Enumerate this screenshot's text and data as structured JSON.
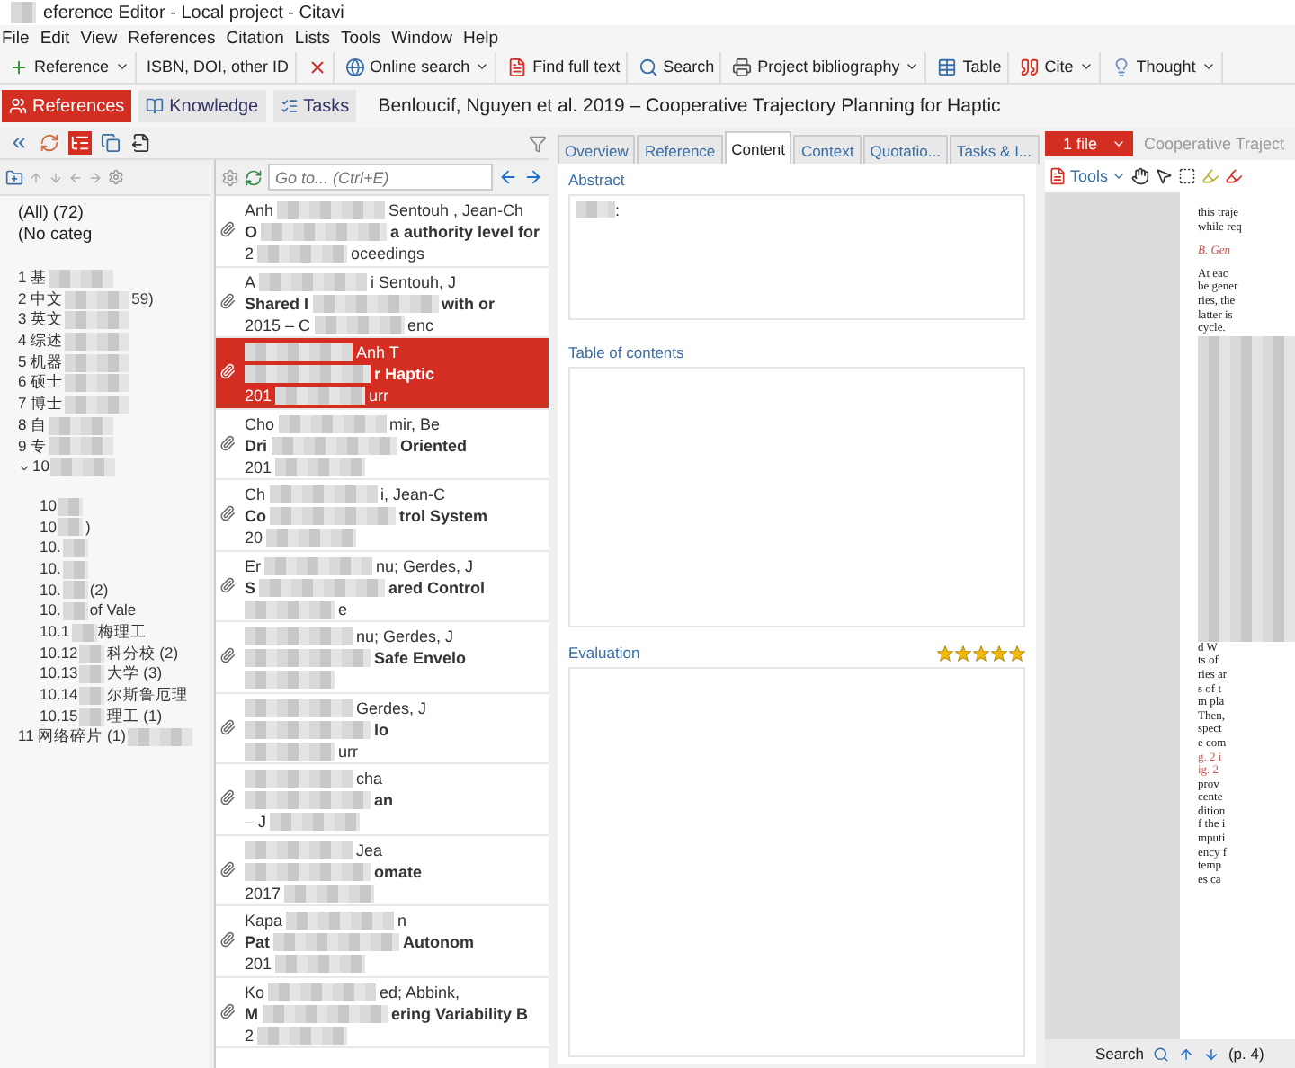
{
  "window": {
    "title": "eference Editor - Local project - Citavi"
  },
  "menu": [
    "File",
    "Edit",
    "View",
    "References",
    "Citation",
    "Lists",
    "Tools",
    "Window",
    "Help"
  ],
  "toolbar": [
    {
      "kind": "button",
      "label": "Reference",
      "dropdown": true
    },
    {
      "kind": "button",
      "label": "ISBN, DOI, other ID",
      "dropdown": false
    },
    {
      "kind": "delete"
    },
    {
      "kind": "button",
      "label": "Online search",
      "dropdown": true
    },
    {
      "kind": "button",
      "label": "Find full text",
      "dropdown": false
    },
    {
      "kind": "button",
      "label": "Search",
      "dropdown": false
    },
    {
      "kind": "button",
      "label": "Project bibliography",
      "dropdown": true
    },
    {
      "kind": "button",
      "label": "Table",
      "dropdown": false
    },
    {
      "kind": "button",
      "label": "Cite",
      "dropdown": true
    },
    {
      "kind": "button",
      "label": "Thought",
      "dropdown": true
    }
  ],
  "nav_tabs": [
    {
      "label": "References",
      "selected": true
    },
    {
      "label": "Knowledge",
      "selected": false
    },
    {
      "label": "Tasks",
      "selected": false
    }
  ],
  "heading": "Benloucif, Nguyen et al. 2019 – Cooperative Trajectory Planning for Haptic",
  "categories": {
    "fixed": [
      "(All) (72)",
      "(No categ"
    ],
    "tree": [
      {
        "start": "1 基"
      },
      {
        "start": "2 中文",
        "end": "59)"
      },
      {
        "start": "3 英文"
      },
      {
        "start": "4 综述"
      },
      {
        "start": "5 机器"
      },
      {
        "start": "6 硕士"
      },
      {
        "start": "7 博士"
      },
      {
        "start": "8 自"
      },
      {
        "start": "9 专"
      },
      {
        "start": "10",
        "children": [
          {
            "start": "10"
          },
          {
            "start": "10",
            "end": ")"
          },
          {
            "start": "10."
          },
          {
            "start": "10."
          },
          {
            "start": "10.",
            "end": "(2)"
          },
          {
            "start": "10.",
            "end": "of Vale"
          },
          {
            "start": "10.1",
            "end": "梅理工"
          },
          {
            "start": "10.12",
            "end": "科分校 (2)"
          },
          {
            "start": "10.13",
            "end": "大学 (3)"
          },
          {
            "start": "10.14",
            "end": "尔斯鲁厄理"
          },
          {
            "start": "10.15",
            "end": "理工 (1)"
          }
        ]
      },
      {
        "start": "11 网络碎片 (1)"
      }
    ]
  },
  "references": {
    "goto_placeholder": "Go to... (Ctrl+E)",
    "rows": [
      {
        "selected": false,
        "authors": {
          "start": "Anh",
          "end": "Sentouh , Jean-Ch"
        },
        "title": {
          "start": "O",
          "end": "a authority level for"
        },
        "meta": {
          "start": "2",
          "end": "oceedings"
        }
      },
      {
        "selected": false,
        "authors": {
          "start": "A",
          "end": "i Sentouh, J"
        },
        "title": {
          "start": "Shared I",
          "end": "with or"
        },
        "meta": {
          "start": "2015 – C",
          "end": "enc"
        }
      },
      {
        "selected": true,
        "authors": {
          "end": "Anh T"
        },
        "title": {
          "end": "r Haptic"
        },
        "meta": {
          "start": "201",
          "end": "urr"
        }
      },
      {
        "selected": false,
        "authors": {
          "start": "Cho",
          "end": "mir, Be"
        },
        "title": {
          "start": "Dri",
          "end": "Oriented"
        },
        "meta": {
          "start": "201"
        }
      },
      {
        "selected": false,
        "authors": {
          "start": "Ch",
          "end": "i, Jean-C"
        },
        "title": {
          "start": "Co",
          "end": "trol System"
        },
        "meta": {
          "start": "20"
        }
      },
      {
        "selected": false,
        "authors": {
          "start": "Er",
          "end": "nu; Gerdes, J"
        },
        "title": {
          "start": "S",
          "end": "ared Control"
        },
        "meta": {
          "end": "e"
        }
      },
      {
        "selected": false,
        "authors": {
          "end": "nu; Gerdes, J"
        },
        "title": {
          "end": "Safe Envelo"
        },
        "meta": {}
      },
      {
        "selected": false,
        "authors": {
          "end": "Gerdes, J"
        },
        "title": {
          "end": "lo"
        },
        "meta": {
          "end": "urr"
        }
      },
      {
        "selected": false,
        "authors": {
          "end": "cha"
        },
        "title": {
          "end": "an"
        },
        "meta": {
          "start": "– J"
        }
      },
      {
        "selected": false,
        "authors": {
          "end": "Jea"
        },
        "title": {
          "end": "omate"
        },
        "meta": {
          "start": "2017"
        }
      },
      {
        "selected": false,
        "authors": {
          "start": "Kapa",
          "end": "n"
        },
        "title": {
          "start": "Pat",
          "end": "Autonom"
        },
        "meta": {
          "start": "201"
        }
      },
      {
        "selected": false,
        "authors": {
          "start": "Ko",
          "end": "ed; Abbink,"
        },
        "title": {
          "start": "M",
          "end": "ering Variability B"
        },
        "meta": {
          "start": "2"
        }
      }
    ]
  },
  "details": {
    "tabs": [
      {
        "label": "Overview",
        "selected": false
      },
      {
        "label": "Reference",
        "selected": false
      },
      {
        "label": "Content",
        "selected": true
      },
      {
        "label": "Context",
        "selected": false
      },
      {
        "label": "Quotatio...",
        "selected": false
      },
      {
        "label": "Tasks & I...",
        "selected": false
      }
    ],
    "abstract": {
      "label": "Abstract",
      "text": ":"
    },
    "toc": {
      "label": "Table of contents"
    },
    "evaluation": {
      "label": "Evaluation",
      "stars": 5
    }
  },
  "pdf": {
    "file_button": "1 file",
    "doc_tab": "Cooperative Traject",
    "tools": "Tools",
    "top_lines": [
      {
        "text": "this traje",
        "kind": "body"
      },
      {
        "text": "while req",
        "kind": "body"
      },
      {
        "text": "B. Gen",
        "kind": "heading"
      },
      {
        "text": "At eac",
        "kind": "body"
      },
      {
        "text": "be gener",
        "kind": "body"
      },
      {
        "text": "ries, the",
        "kind": "body"
      },
      {
        "text": "latter is",
        "kind": "body"
      },
      {
        "text": "cycle.",
        "kind": "body"
      }
    ],
    "bottom_lines": [
      {
        "text": "d W",
        "kind": "body"
      },
      {
        "text": "ts of",
        "kind": "body"
      },
      {
        "text": "ries ar",
        "kind": "body"
      },
      {
        "text": "s of t",
        "kind": "body"
      },
      {
        "text": "m pla",
        "kind": "body"
      },
      {
        "text": "Then,",
        "kind": "body"
      },
      {
        "text": "spect",
        "kind": "body"
      },
      {
        "text": "e com",
        "kind": "body"
      },
      {
        "text": "g. 2 i",
        "kind": "ref"
      },
      {
        "text": "ig. 2",
        "kind": "ref"
      },
      {
        "text": "prov",
        "kind": "body"
      },
      {
        "text": "cente",
        "kind": "body"
      },
      {
        "text": "dition",
        "kind": "body"
      },
      {
        "text": "f the i",
        "kind": "body"
      },
      {
        "text": "mputi",
        "kind": "body"
      },
      {
        "text": "ency f",
        "kind": "body"
      },
      {
        "text": "temp",
        "kind": "body"
      },
      {
        "text": "es ca",
        "kind": "body"
      }
    ],
    "search": "Search",
    "page": "(p. 4)"
  }
}
